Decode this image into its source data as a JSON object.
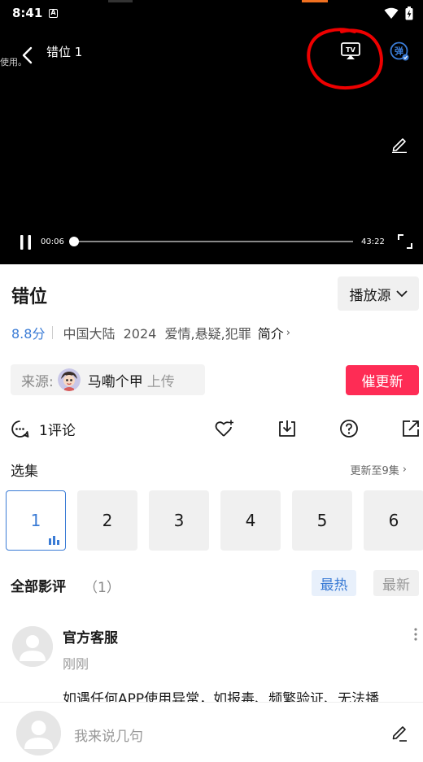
{
  "status_bar": {
    "time": "8:41",
    "notification_glyph": "A"
  },
  "player": {
    "cut_off_text": "使用。",
    "title": "错位 1",
    "tv_label": "TV",
    "danmu_label": "弹",
    "current_time": "00:06",
    "total_time": "43:22",
    "progress_fraction": 0.002
  },
  "info": {
    "title": "错位",
    "source_label": "播放源",
    "rating": "8.8分",
    "meta": "中国大陆  2024  爱情,悬疑,犯罪",
    "intro": "简介",
    "uploader_prefix": "来源:",
    "uploader_name": "马嘞个甲",
    "uploader_suffix": "上传",
    "urge_label": "催更新"
  },
  "actions": {
    "comment_count": "1评论"
  },
  "episodes": {
    "label": "选集",
    "update_status": "更新至9集",
    "items": [
      "1",
      "2",
      "3",
      "4",
      "5",
      "6"
    ],
    "active_index": 0
  },
  "reviews": {
    "title": "全部影评",
    "count": "（1）",
    "sort_hot": "最热",
    "sort_new": "最新",
    "items": [
      {
        "author": "官方客服",
        "time": "刚刚",
        "text": "如遇任何APP使用异常，如报毒、频繁验证、无法播"
      }
    ]
  },
  "input": {
    "placeholder": "我来说几句"
  },
  "colors": {
    "accent": "#3a7bd5",
    "urge": "#fe2c55",
    "annotation": "#ee0000"
  }
}
